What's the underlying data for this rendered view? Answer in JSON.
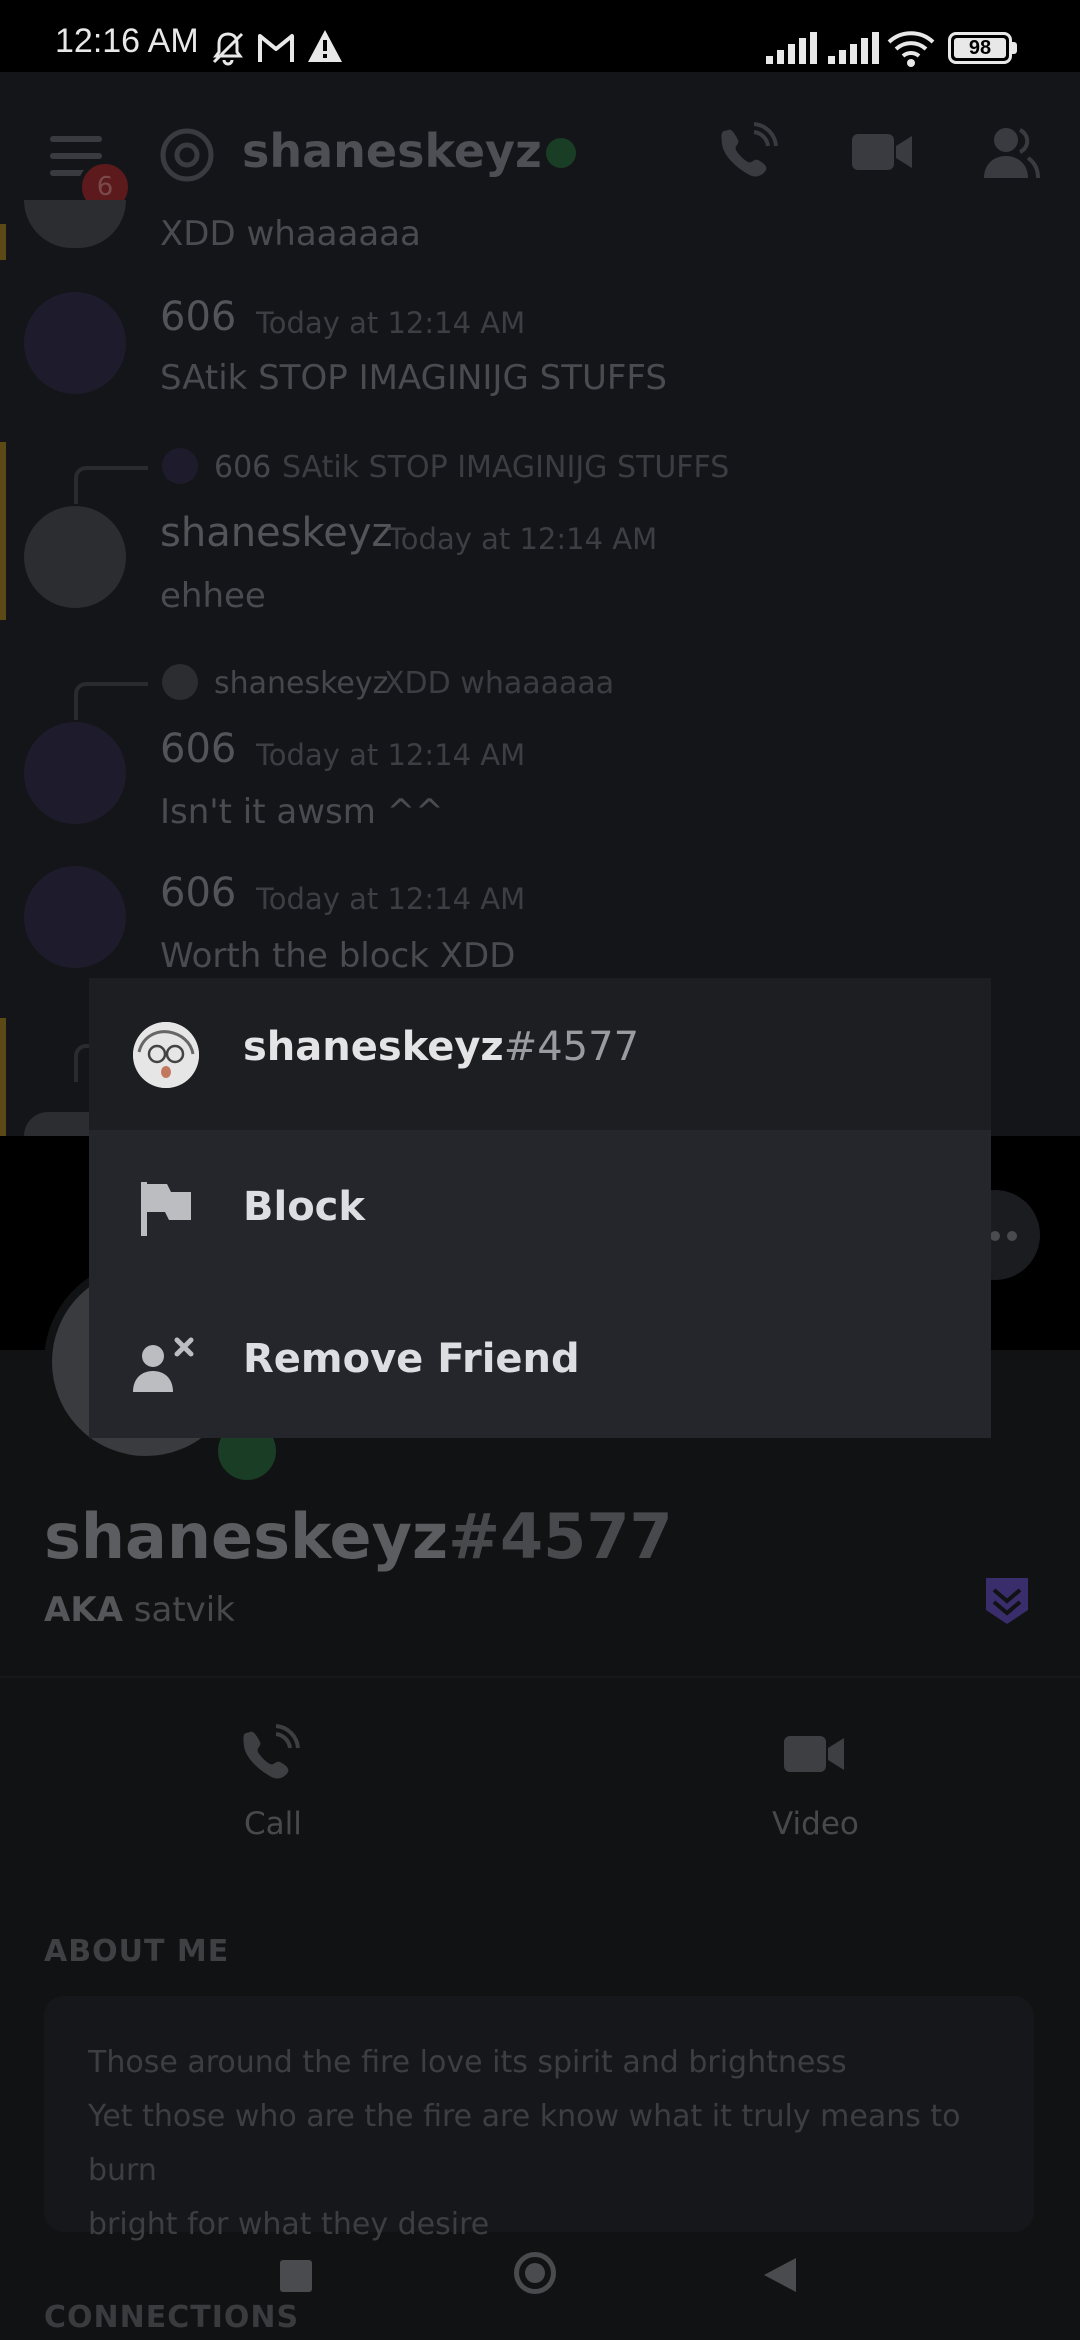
{
  "status_bar": {
    "time": "12:16 AM",
    "battery": "98"
  },
  "header": {
    "channel_name": "shaneskeyz",
    "menu_badge": "6"
  },
  "messages": [
    {
      "id": "m0",
      "text": "XDD whaaaaaa"
    },
    {
      "id": "m1",
      "author": "606",
      "time": "Today at 12:14 AM",
      "text": "SAtik STOP IMAGINIJG STUFFS"
    },
    {
      "id": "m2",
      "reply_author": "606",
      "reply_text": "SAtik STOP IMAGINIJG STUFFS",
      "author": "shaneskeyz",
      "time": "Today at 12:14 AM",
      "text": "ehhee"
    },
    {
      "id": "m3",
      "reply_author": "shaneskeyz",
      "reply_text": "XDD whaaaaaa",
      "author": "606",
      "time": "Today at 12:14 AM",
      "text": "Isn't it awsm ^^"
    },
    {
      "id": "m4",
      "author": "606",
      "time": "Today at 12:14 AM",
      "text": "Worth the block XDD"
    }
  ],
  "profile": {
    "username": "shaneskeyz",
    "discriminator": "#4577",
    "aka_label": "AKA",
    "aka_value": "satvik",
    "call_label": "Call",
    "video_label": "Video",
    "about_heading": "ABOUT ME",
    "about_line1": "Those around the fire love its spirit and brightness",
    "about_line2": "Yet those who are the fire are know what it truly means to burn",
    "about_line3": "bright for what they desire",
    "connections_heading": "CONNECTIONS"
  },
  "context_menu": {
    "username": "shaneskeyz",
    "discriminator": "#4577",
    "items": [
      {
        "label": "Block",
        "icon": "flag-icon"
      },
      {
        "label": "Remove Friend",
        "icon": "remove-friend-icon"
      }
    ]
  },
  "colors": {
    "overlay_menu_bg": "#25262b",
    "online_green": "#3ba55d",
    "badge_red": "#ed4245",
    "mention_bar": "#f0b232"
  }
}
